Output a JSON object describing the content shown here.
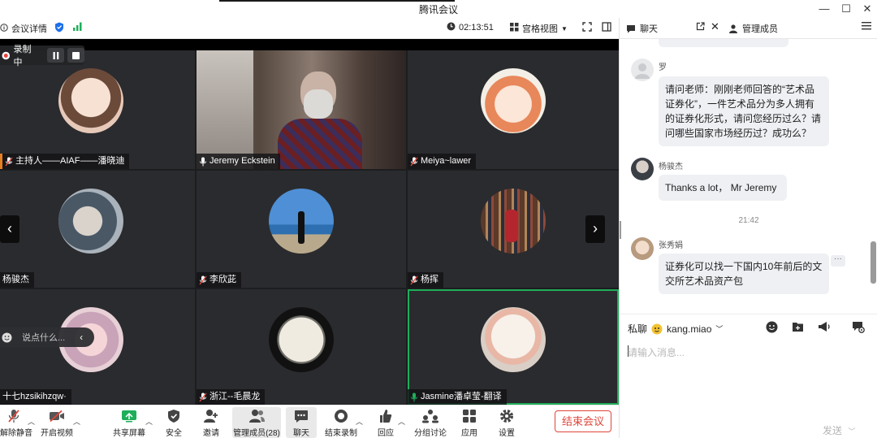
{
  "window": {
    "title": "腾讯会议",
    "minimize": "—",
    "maximize": "☐",
    "close": "✕"
  },
  "toolbar": {
    "meeting_details": "会议详情",
    "timer": "02:13:51",
    "view_label": "宫格视图"
  },
  "recording": {
    "label": "录制中"
  },
  "grid": {
    "tiles": [
      {
        "name": "主持人——AIAF——潘晓迪"
      },
      {
        "name": "Jeremy Eckstein"
      },
      {
        "name": "Meiya~lawer"
      },
      {
        "name": "杨骏杰"
      },
      {
        "name": "李欣茈"
      },
      {
        "name": "杨挥"
      },
      {
        "name": "十七hzsikihzqw·"
      },
      {
        "name": "浙江--毛晨龙"
      },
      {
        "name": "Jasmine潘卓莹-翻译"
      }
    ],
    "say_something": "说点什么..."
  },
  "bottombar": {
    "buttons": [
      {
        "label": "解除静音"
      },
      {
        "label": "开启视频"
      },
      {
        "label": "共享屏幕"
      },
      {
        "label": "安全"
      },
      {
        "label": "邀请"
      },
      {
        "label": "管理成员(28)"
      },
      {
        "label": "聊天"
      },
      {
        "label": "结束录制"
      },
      {
        "label": "回应"
      },
      {
        "label": "分组讨论"
      },
      {
        "label": "应用"
      },
      {
        "label": "设置"
      }
    ],
    "end_meeting": "结束会议"
  },
  "panel": {
    "tab_chat": "聊天",
    "tab_members": "管理成员",
    "messages": [
      {
        "sender": "罗",
        "text": "请问老师：刚刚老师回答的“艺术品证券化”，一件艺术品分为多人拥有的证券化形式，请问您经历过么？请问哪些国家市场经历过？成功么？"
      },
      {
        "sender": "杨骏杰",
        "text": "Thanks a lot， Mr Jeremy"
      },
      {
        "sender": "张秀娟",
        "text": "证券化可以找一下国内10年前后的文交所艺术品资产包"
      }
    ],
    "time_divider": "21:42",
    "private_label": "私聊",
    "recipient": "kang.miao",
    "input_placeholder": "请输入消息...",
    "send_label": "发送"
  },
  "colors": {
    "accent_green": "#1fae5a",
    "end_red": "#e0453a",
    "bubble": "#eef0f3"
  }
}
